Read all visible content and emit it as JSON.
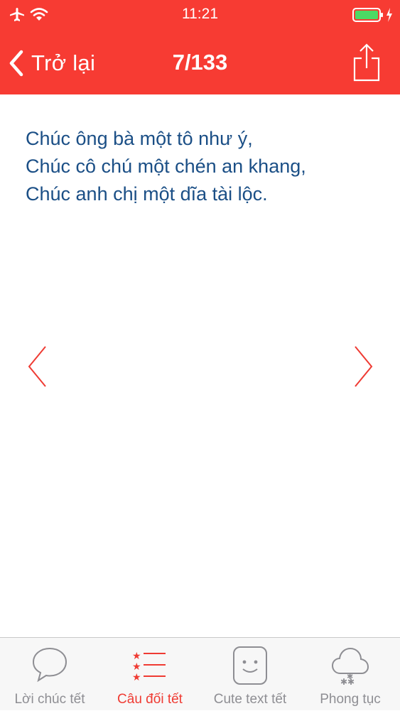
{
  "status_bar": {
    "time": "11:21",
    "icons": [
      "airplane-icon",
      "wifi-icon",
      "battery-icon",
      "charging-icon"
    ]
  },
  "nav": {
    "back_label": "Trở lại",
    "title": "7/133",
    "share_icon": "share-icon"
  },
  "content": {
    "lines": [
      "Chúc ông bà một tô như ý,",
      "Chúc cô chú một chén an khang,",
      "Chúc anh chị một dĩa tài lộc."
    ]
  },
  "pager": {
    "prev_icon": "chevron-left-icon",
    "next_icon": "chevron-right-icon"
  },
  "tabs": [
    {
      "label": "Lời chúc tết",
      "icon": "speech-bubble-icon",
      "active": false
    },
    {
      "label": "Câu đối tết",
      "icon": "star-list-icon",
      "active": true
    },
    {
      "label": "Cute text tết",
      "icon": "smiley-face-icon",
      "active": false
    },
    {
      "label": "Phong tục",
      "icon": "cloud-snow-icon",
      "active": false
    }
  ],
  "colors": {
    "header": "#f73b33",
    "accent": "#ef3b33",
    "text": "#1b4f86",
    "tab_inactive": "#8e8e93",
    "tab_bar": "#f7f7f7"
  }
}
